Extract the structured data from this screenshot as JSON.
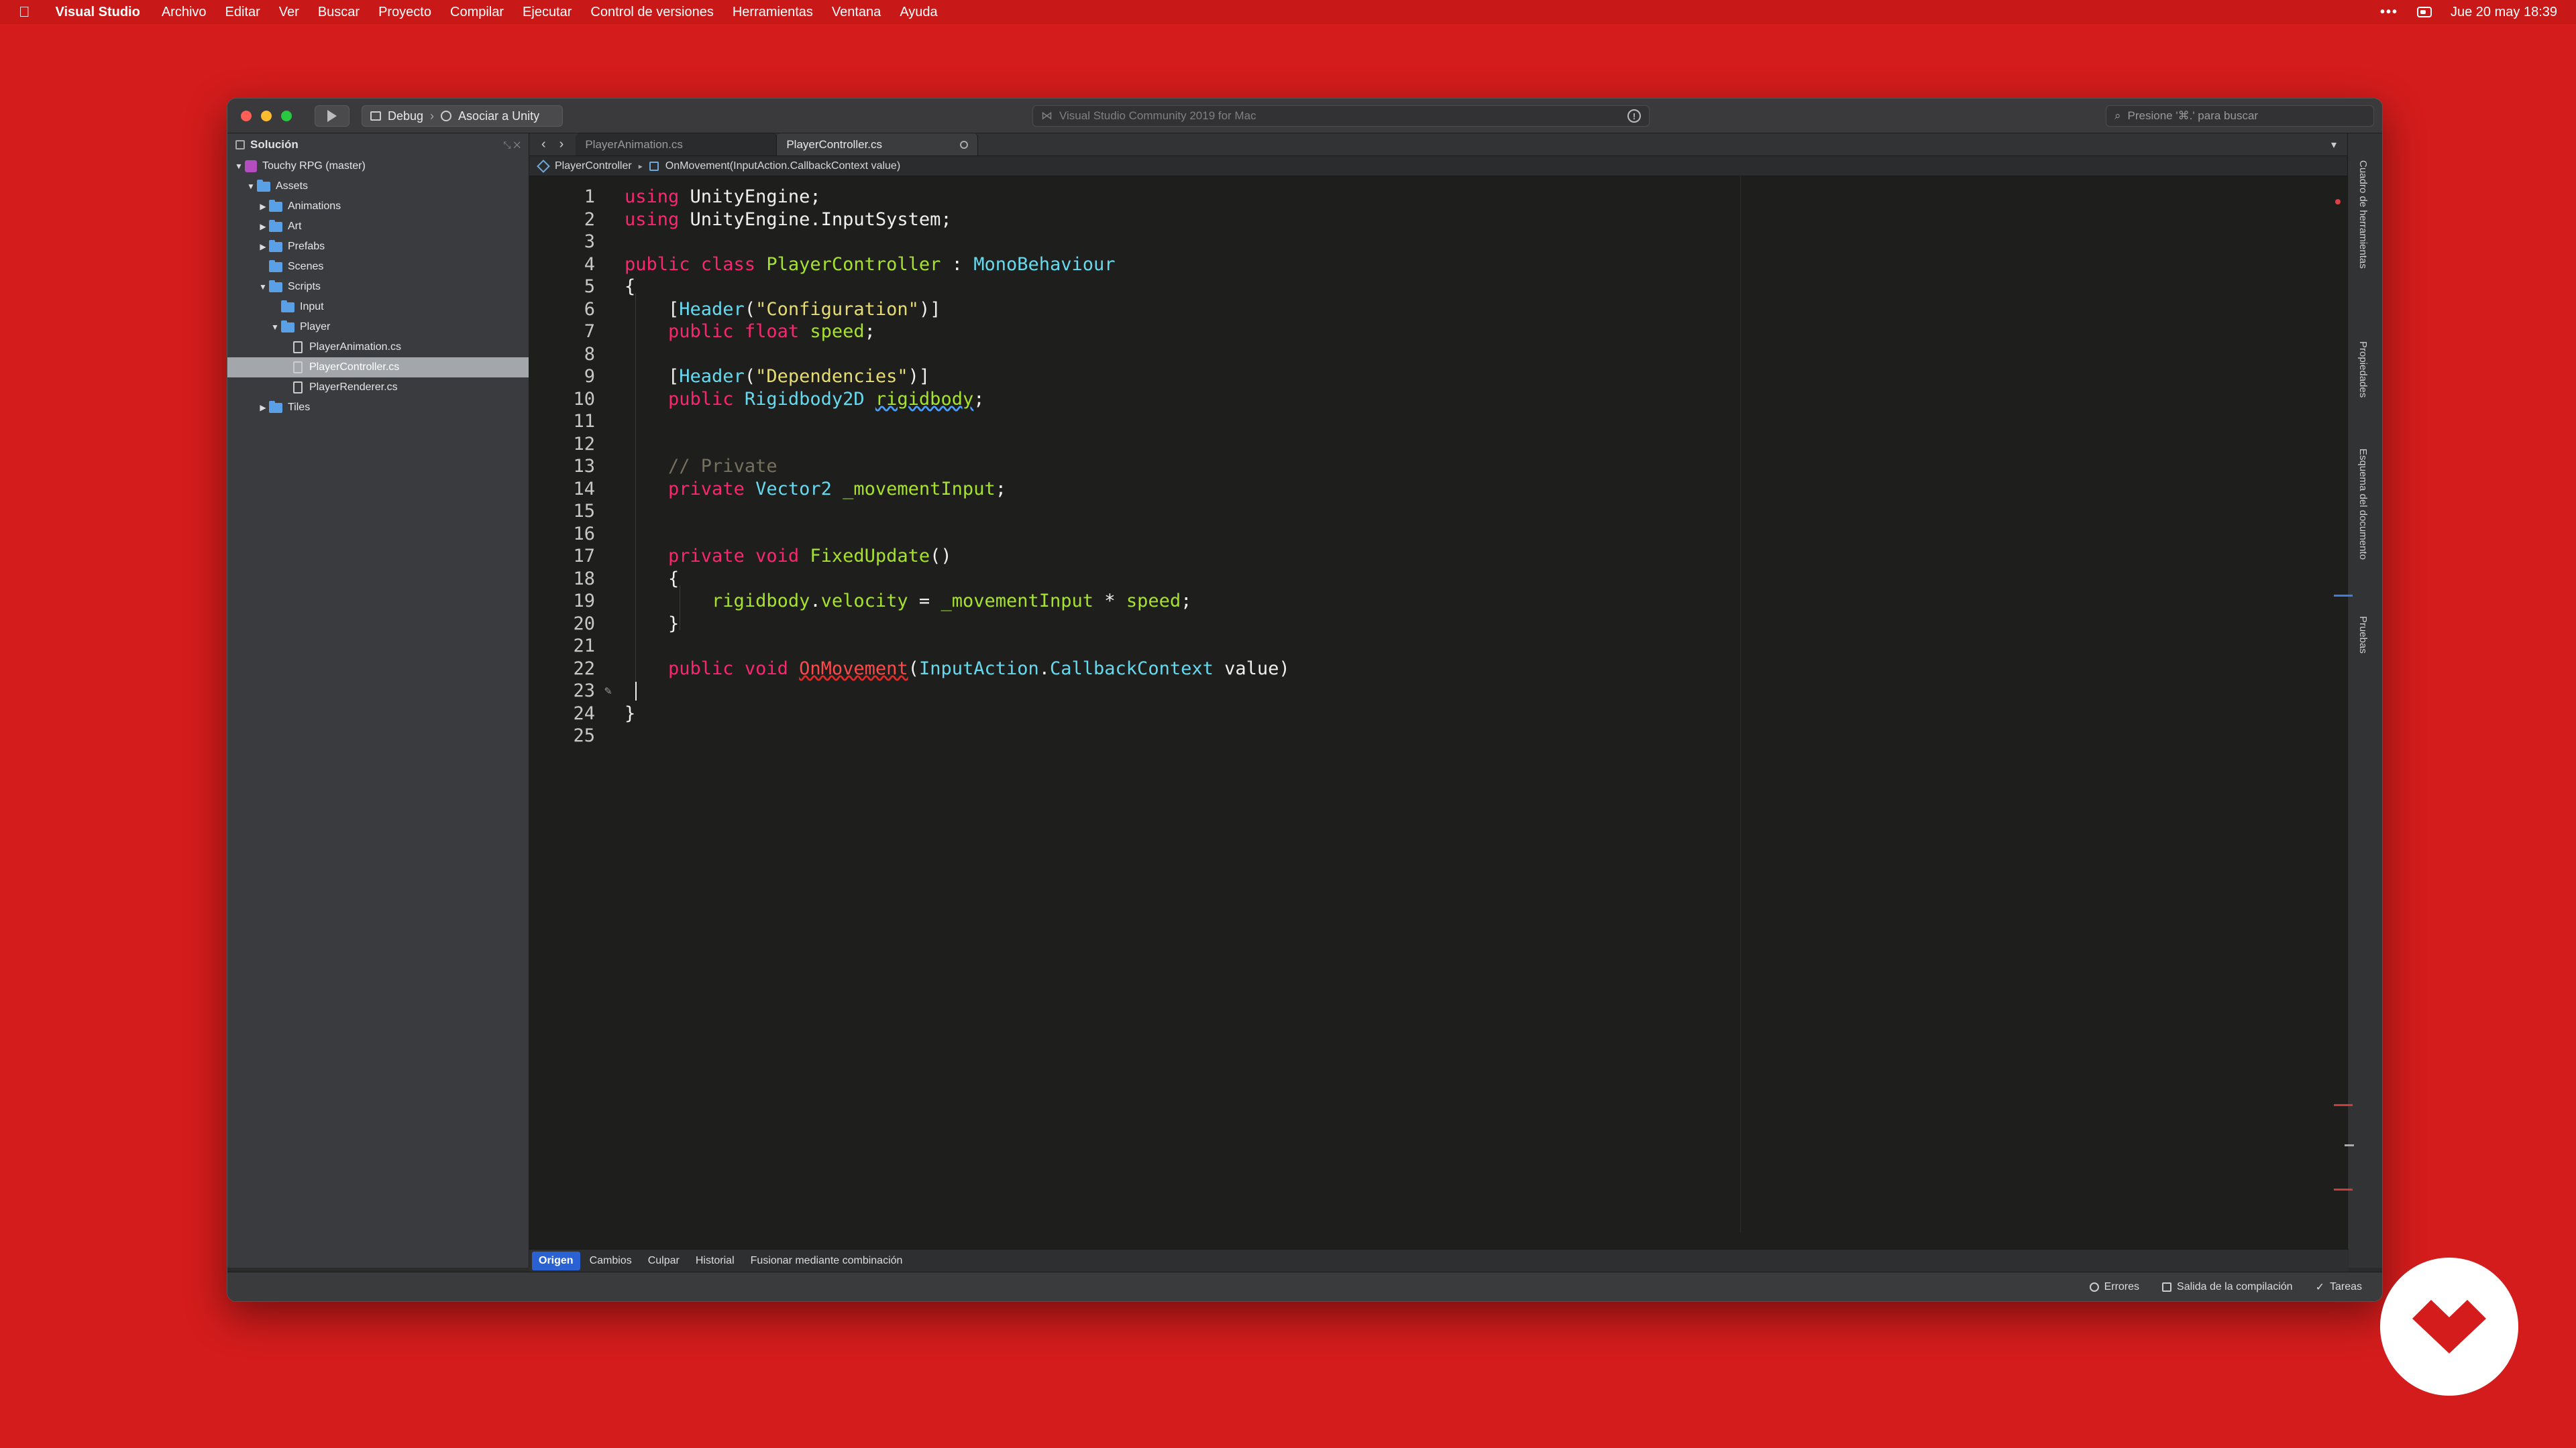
{
  "menubar": {
    "app_name": "Visual Studio",
    "items": [
      "Archivo",
      "Editar",
      "Ver",
      "Buscar",
      "Proyecto",
      "Compilar",
      "Ejecutar",
      "Control de versiones",
      "Herramientas",
      "Ventana",
      "Ayuda"
    ],
    "dots": "•••",
    "datetime": "Jue 20 may  18:39"
  },
  "toolbar": {
    "config": "Debug",
    "target": "Asociar a Unity",
    "status_text": "Visual Studio Community 2019 for Mac",
    "search_placeholder": "Presione '⌘.' para buscar"
  },
  "solution": {
    "header": "Solución",
    "tree": [
      {
        "label": "Touchy RPG (master)",
        "kind": "solution",
        "depth": 0,
        "expanded": true
      },
      {
        "label": "Assets",
        "kind": "folder",
        "depth": 1,
        "expanded": true
      },
      {
        "label": "Animations",
        "kind": "folder",
        "depth": 2,
        "expanded": false
      },
      {
        "label": "Art",
        "kind": "folder",
        "depth": 2,
        "expanded": false
      },
      {
        "label": "Prefabs",
        "kind": "folder",
        "depth": 2,
        "expanded": false
      },
      {
        "label": "Scenes",
        "kind": "folder",
        "depth": 2,
        "expanded": null
      },
      {
        "label": "Scripts",
        "kind": "folder",
        "depth": 2,
        "expanded": true
      },
      {
        "label": "Input",
        "kind": "folder",
        "depth": 3,
        "expanded": null
      },
      {
        "label": "Player",
        "kind": "folder",
        "depth": 3,
        "expanded": true
      },
      {
        "label": "PlayerAnimation.cs",
        "kind": "file",
        "depth": 4
      },
      {
        "label": "PlayerController.cs",
        "kind": "file",
        "depth": 4,
        "selected": true
      },
      {
        "label": "PlayerRenderer.cs",
        "kind": "file",
        "depth": 4
      },
      {
        "label": "Tiles",
        "kind": "folder",
        "depth": 2,
        "expanded": false
      }
    ]
  },
  "tabs": [
    {
      "label": "PlayerAnimation.cs",
      "active": false
    },
    {
      "label": "PlayerController.cs",
      "active": true
    }
  ],
  "breadcrumbs": {
    "class": "PlayerController",
    "method": "OnMovement(InputAction.CallbackContext value)"
  },
  "code_lines": [
    [
      [
        "kw",
        "using"
      ],
      [
        "t",
        " UnityEngine;"
      ]
    ],
    [
      [
        "kw",
        "using"
      ],
      [
        "t",
        " UnityEngine.InputSystem;"
      ]
    ],
    [],
    [
      [
        "kw",
        "public class "
      ],
      [
        "fn",
        "PlayerController"
      ],
      [
        "t",
        " : "
      ],
      [
        "ty",
        "MonoBehaviour"
      ]
    ],
    [
      [
        "t",
        "{"
      ]
    ],
    [
      [
        "t",
        "    ["
      ],
      [
        "ty",
        "Header"
      ],
      [
        "t",
        "("
      ],
      [
        "st",
        "\"Configuration\""
      ],
      [
        "t",
        ")]"
      ]
    ],
    [
      [
        "t",
        "    "
      ],
      [
        "kw",
        "public float "
      ],
      [
        "id",
        "speed"
      ],
      [
        "t",
        ";"
      ]
    ],
    [],
    [
      [
        "t",
        "    ["
      ],
      [
        "ty",
        "Header"
      ],
      [
        "t",
        "("
      ],
      [
        "st",
        "\"Dependencies\""
      ],
      [
        "t",
        ")]"
      ]
    ],
    [
      [
        "t",
        "    "
      ],
      [
        "kw",
        "public "
      ],
      [
        "ty",
        "Rigidbody2D "
      ],
      [
        "warn",
        "rigidbody"
      ],
      [
        "t",
        ";"
      ]
    ],
    [],
    [],
    [
      [
        "t",
        "    "
      ],
      [
        "cm",
        "// Private"
      ]
    ],
    [
      [
        "t",
        "    "
      ],
      [
        "kw",
        "private "
      ],
      [
        "ty",
        "Vector2 "
      ],
      [
        "id",
        "_movementInput"
      ],
      [
        "t",
        ";"
      ]
    ],
    [],
    [],
    [
      [
        "t",
        "    "
      ],
      [
        "kw",
        "private void "
      ],
      [
        "fn",
        "FixedUpdate"
      ],
      [
        "t",
        "()"
      ]
    ],
    [
      [
        "t",
        "    {"
      ]
    ],
    [
      [
        "t",
        "        "
      ],
      [
        "id",
        "rigidbody"
      ],
      [
        "t",
        "."
      ],
      [
        "id",
        "velocity"
      ],
      [
        "t",
        " = "
      ],
      [
        "id",
        "_movementInput"
      ],
      [
        "t",
        " * "
      ],
      [
        "id",
        "speed"
      ],
      [
        "t",
        ";"
      ]
    ],
    [
      [
        "t",
        "    }"
      ]
    ],
    [],
    [
      [
        "t",
        "    "
      ],
      [
        "kw",
        "public void "
      ],
      [
        "err",
        "OnMovement"
      ],
      [
        "t",
        "("
      ],
      [
        "ty",
        "InputAction"
      ],
      [
        "t",
        "."
      ],
      [
        "ty",
        "CallbackContext"
      ],
      [
        "t",
        " value)"
      ]
    ],
    [],
    [
      [
        "t",
        "}"
      ]
    ],
    []
  ],
  "vc_tabs": [
    {
      "label": "Origen",
      "active": true
    },
    {
      "label": "Cambios",
      "active": false
    },
    {
      "label": "Culpar",
      "active": false
    },
    {
      "label": "Historial",
      "active": false
    },
    {
      "label": "Fusionar mediante combinación",
      "active": false
    }
  ],
  "right_pads": [
    "Cuadro de herramientas",
    "Propiedades",
    "Esquema del documento",
    "Pruebas"
  ],
  "status": {
    "errors": "Errores",
    "build_output": "Salida de la compilación",
    "tasks": "Tareas"
  },
  "colors": {
    "background": "#d41c1c",
    "keyword": "#f92672",
    "type": "#66d9ef",
    "string": "#e6db74",
    "identifier": "#a6e22e",
    "comment": "#75715e",
    "accent": "#2a62d4"
  }
}
